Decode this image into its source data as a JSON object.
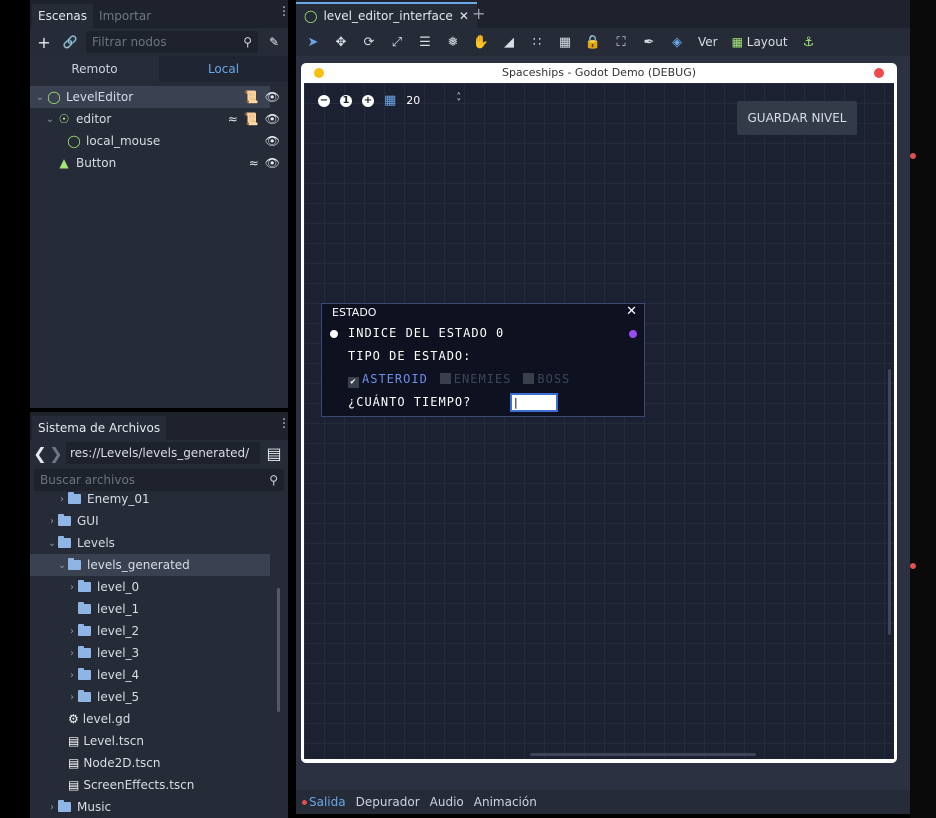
{
  "scene_dock": {
    "tabs": [
      "Escenas",
      "Importar"
    ],
    "filter_placeholder": "Filtrar nodos",
    "remote_label": "Remoto",
    "local_label": "Local",
    "nodes": [
      {
        "label": "LevelEditor",
        "icon": "node2d-icon",
        "selected": true
      },
      {
        "label": "editor",
        "icon": "node-icon"
      },
      {
        "label": "local_mouse",
        "icon": "node2d-icon"
      },
      {
        "label": "Button",
        "icon": "button-icon"
      }
    ]
  },
  "fs_dock": {
    "title": "Sistema de Archivos",
    "path": "res://Levels/levels_generated/",
    "search_placeholder": "Buscar archivos",
    "items": [
      {
        "label": "Enemy_01",
        "type": "folder"
      },
      {
        "label": "GUI",
        "type": "folder"
      },
      {
        "label": "Levels",
        "type": "folder"
      },
      {
        "label": "levels_generated",
        "type": "folder",
        "selected": true
      },
      {
        "label": "level_0",
        "type": "folder"
      },
      {
        "label": "level_1",
        "type": "folder"
      },
      {
        "label": "level_2",
        "type": "folder"
      },
      {
        "label": "level_3",
        "type": "folder"
      },
      {
        "label": "level_4",
        "type": "folder"
      },
      {
        "label": "level_5",
        "type": "folder"
      },
      {
        "label": "level.gd",
        "type": "script"
      },
      {
        "label": "Level.tscn",
        "type": "scene"
      },
      {
        "label": "Node2D.tscn",
        "type": "scene"
      },
      {
        "label": "ScreenEffects.tscn",
        "type": "scene"
      },
      {
        "label": "Music",
        "type": "folder"
      }
    ]
  },
  "editor": {
    "scene_tab": "level_editor_interface",
    "toolbar": {
      "view_label": "Ver",
      "layout_label": "Layout"
    }
  },
  "game_window": {
    "title": "Spaceships - Godot Demo (DEBUG)",
    "zoom_value": "20",
    "save_button": "GUARDAR NIVEL",
    "estado": {
      "title": "ESTADO",
      "line1": "INDICE DEL ESTADO 0",
      "line2": "TIPO DE ESTADO:",
      "options": [
        "ASTEROID",
        "ENEMIES",
        "BOSS"
      ],
      "time_label": "¿CUÁNTO TIEMPO?",
      "time_value": "|"
    }
  },
  "bottom_bar": {
    "tabs": [
      "Salida",
      "Depurador",
      "Audio",
      "Animación"
    ]
  },
  "colors": {
    "accent": "#6aa7e8",
    "panel": "#252b37",
    "game_bg": "#1b2131"
  }
}
